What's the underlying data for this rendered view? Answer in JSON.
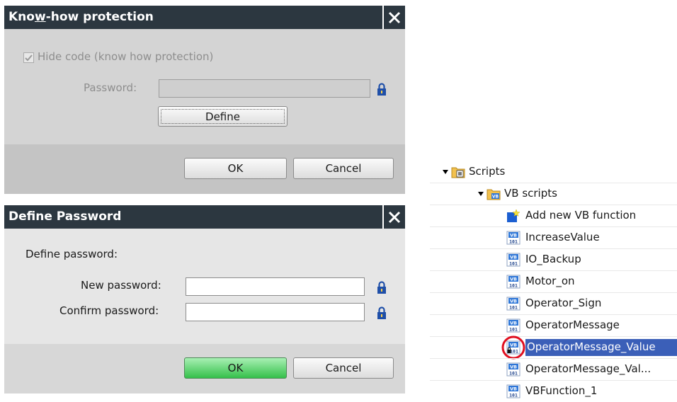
{
  "knowhow_dialog": {
    "title_pre": "Kno",
    "title_mnemonic": "w",
    "title_post": "-how protection",
    "hide_code_label": "Hide code (know how protection)",
    "password_label": "Password:",
    "define_button": "Define",
    "ok_button": "OK",
    "cancel_button": "Cancel"
  },
  "password_dialog": {
    "title": "Define Password",
    "heading": "Define password:",
    "new_password_label": "New password:",
    "confirm_password_label": "Confirm password:",
    "ok_button": "OK",
    "cancel_button": "Cancel"
  },
  "tree": {
    "scripts_label": "Scripts",
    "vb_scripts_label": "VB scripts",
    "items": [
      {
        "label": "Add new VB function",
        "icon": "add-function-icon"
      },
      {
        "label": "IncreaseValue",
        "icon": "vb-script-icon"
      },
      {
        "label": "IO_Backup",
        "icon": "vb-script-icon"
      },
      {
        "label": "Motor_on",
        "icon": "vb-script-icon"
      },
      {
        "label": "Operator_Sign",
        "icon": "vb-script-icon"
      },
      {
        "label": "OperatorMessage",
        "icon": "vb-script-icon"
      },
      {
        "label": "OperatorMessage_Value",
        "icon": "vb-script-protected-icon",
        "selected": true
      },
      {
        "label": "OperatorMessage_Val...",
        "icon": "vb-script-icon"
      },
      {
        "label": "VBFunction_1",
        "icon": "vb-script-icon"
      }
    ]
  },
  "colors": {
    "titlebar": "#2c3740",
    "selection": "#3b5fb8",
    "ok_green": "#35c04a",
    "lock": "#1f4fa8",
    "highlight_circle": "#e01020"
  }
}
